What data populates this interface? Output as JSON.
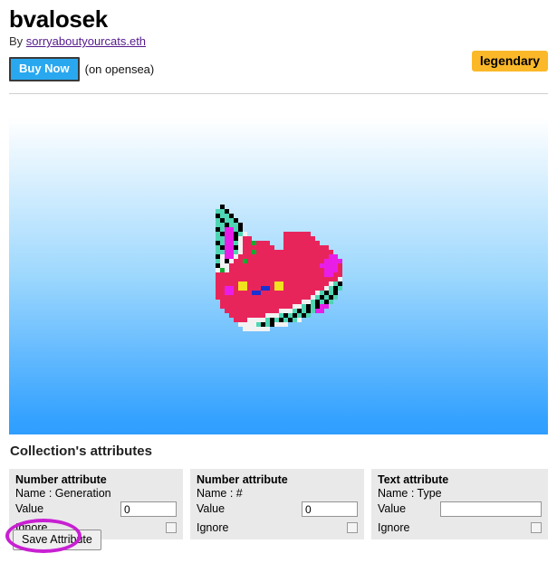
{
  "header": {
    "title": "bvalosek",
    "by_prefix": "By",
    "author_link": "sorryaboutyourcats.eth",
    "buy_label": "Buy Now",
    "buy_note": "(on opensea)",
    "rarity_badge": "legendary"
  },
  "artwork": {
    "alt": "pixel-art cat face on blue gradient background",
    "background_top": "#ffffff",
    "background_bottom": "#2f9eff",
    "pixel_size": 5,
    "palette": {
      "0": "transparent",
      "p": "#e8255b",
      "k": "#000000",
      "w": "#f2f2f2",
      "t": "#4ed6b4",
      "m": "#e81ee8",
      "y": "#f0e21e",
      "b": "#1a32d2",
      "g": "#19a832"
    },
    "rows": [
      "00000000000000000000000000000000",
      "000k0000000000000000000000000000",
      "00ttk000000000000000000000000000",
      "00kttk00000000000000000000000000",
      "00tkttk0000000000000000000000000",
      "00ttkttk0000000000000000000000000",
      "00ktmmtk000000000000000000000000",
      "00tkmmktw00000000pppppp000000000",
      "00ttmmkwpp0000000ppppppp00000000",
      "00ktmmtwppgppp000pppppppp0000000",
      "00tkmmkwppppppp00pppppppppp00000",
      "00ttmmtwppgppppppppppppppppp0000",
      "00kwmmwppppppppppppppppppppmm000",
      "00twkwppgpppppppppppppppppmmmm00",
      "00kwwppppppppppppppppppppmmmmp00",
      "00wgwpppppppppppppppppppppmmmp00",
      "00ppppppppppppppppppppppppmmpp00",
      "00pppppppppppppppppppppppppppw00",
      "00pppppyyppppppyyppppppppppwtk00",
      "00ppmmpyypppbbpyypppppppppwtkt00",
      "00ppmmppppbbppppppppppppwtktk000",
      "00pppppppppppppppppppppwtktkt000",
      "000ppppppppppppppppppwwtktkt0000",
      "000ppppppppppppppppwwtktkmm00000",
      "0000ppppppppppppwwwtktktmm000000",
      "00000ppppppppwwwtktktkt000000000",
      "000000pppwwwwtktktktw00000000000",
      "0000000wwwwtktkwww00000000000000",
      "00000000wwwwww000000000000000000",
      "00000000000000000000000000000000"
    ]
  },
  "attributes_section": {
    "heading": "Collection's attributes",
    "cards": [
      {
        "type_label": "Number attribute",
        "name_label": "Name : Generation",
        "value_label": "Value",
        "value": "0",
        "value_placeholder": "",
        "ignore_label": "Ignore",
        "ignore_checked": false
      },
      {
        "type_label": "Number attribute",
        "name_label": "Name : #",
        "value_label": "Value",
        "value": "0",
        "value_placeholder": "",
        "ignore_label": "Ignore",
        "ignore_checked": false
      },
      {
        "type_label": "Text attribute",
        "name_label": "Name : Type",
        "value_label": "Value",
        "value": "",
        "value_placeholder": "",
        "ignore_label": "Ignore",
        "ignore_checked": false
      }
    ],
    "save_label": "Save Attribute",
    "highlight_color": "#c820d2"
  }
}
